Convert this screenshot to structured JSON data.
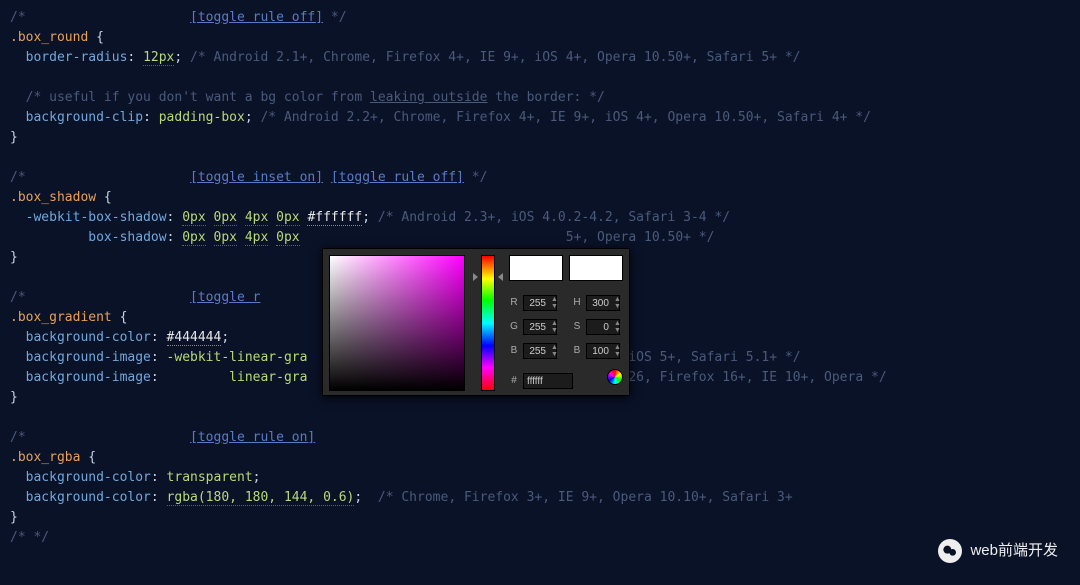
{
  "code": {
    "box_round": {
      "toggle_rule_off": "[toggle rule off]",
      "selector": ".box_round",
      "p1_prop": "border-radius",
      "p1_val": "12px",
      "p1_comment": "/* Android 2.1+, Chrome, Firefox 4+, IE 9+, iOS 4+, Opera 10.50+, Safari 5+ */",
      "useful_comment_a": "/* useful if you don't want a bg color from ",
      "useful_link": "leaking outside",
      "useful_comment_b": " the border: */",
      "p2_prop": "background-clip",
      "p2_val": "padding-box",
      "p2_comment": "/* Android 2.2+, Chrome, Firefox 4+, IE 9+, iOS 4+, Opera 10.50+, Safari 4+ */"
    },
    "box_shadow": {
      "toggle_inset": "[toggle inset on]",
      "toggle_rule_off": "[toggle rule off]",
      "selector": ".box_shadow",
      "p1_prop": "-webkit-box-shadow",
      "p1_v1": "0px",
      "p1_v2": "0px",
      "p1_v3": "4px",
      "p1_v4": "0px",
      "p1_hex": "#ffffff",
      "p1_comment": "/* Android 2.3+, iOS 4.0.2-4.2, Safari 3-4 */",
      "p2_prop": "box-shadow",
      "p2_v1": "0px",
      "p2_v2": "0px",
      "p2_v3": "4px",
      "p2_v4": "0px",
      "p2_comment": "5+, Opera 10.50+ */"
    },
    "box_gradient": {
      "toggle_partial": "[toggle r",
      "selector": ".box_gradient",
      "p1_prop": "background-color",
      "p1_val": "#444444",
      "p2_prop": "background-image",
      "p2_val": "-webkit-linear-gra",
      "p2_tail": "iOS 5+, Safari 5.1+ */",
      "p3_prop": "background-image",
      "p3_val_a": "linear-gra",
      "p3_tail": "26, Firefox 16+, IE 10+, Opera */"
    },
    "box_rgba": {
      "toggle_rule_on": "[toggle rule on]",
      "selector": ".box_rgba",
      "p1_prop": "background-color",
      "p1_val": "transparent",
      "p2_prop": "background-color",
      "p2_val": "rgba(180, 180, 144, 0.6)",
      "p2_comment": "/* Chrome, Firefox 3+, IE 9+, Opera 10.10+, Safari 3+"
    }
  },
  "picker": {
    "r": "255",
    "g": "255",
    "b": "255",
    "h": "300",
    "s": "0",
    "v": "100",
    "hex": "ffffff",
    "lbl_r": "R",
    "lbl_g": "G",
    "lbl_b": "B",
    "lbl_h": "H",
    "lbl_s": "S",
    "lbl_v": "B",
    "lbl_hash": "#"
  },
  "watermark": "web前端开发"
}
